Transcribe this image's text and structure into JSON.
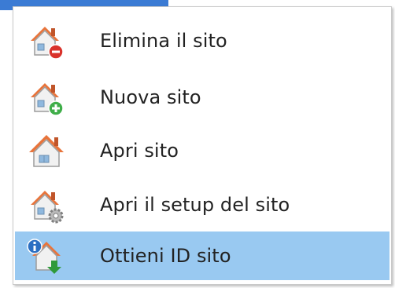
{
  "menu": {
    "items": [
      {
        "label": "Elimina il sito",
        "icon": "house-delete-icon",
        "highlighted": false
      },
      {
        "label": "Nuova sito",
        "icon": "house-add-icon",
        "highlighted": false
      },
      {
        "label": "Apri sito",
        "icon": "house-icon",
        "highlighted": false
      },
      {
        "label": "Apri il setup del sito",
        "icon": "house-settings-icon",
        "highlighted": false
      },
      {
        "label": "Ottieni ID sito",
        "icon": "house-info-download-icon",
        "highlighted": true
      }
    ]
  },
  "colors": {
    "highlight": "#99c9f1",
    "roof": "#e8743b",
    "wall": "#f1f1f1",
    "delete_badge": "#d9322b",
    "add_badge": "#3fae49",
    "info_badge": "#2c6fc2"
  }
}
